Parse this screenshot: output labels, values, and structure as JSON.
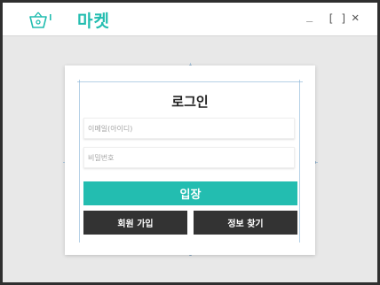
{
  "titlebar": {
    "app_title": "마켓",
    "logo_icon": "basket-icon",
    "minimize_label": "_",
    "maximize_label": "[ ]",
    "close_label": "✕"
  },
  "login": {
    "title": "로그인",
    "email_placeholder": "이메일(아이디)",
    "password_placeholder": "비밀번호",
    "submit_label": "입장",
    "signup_label": "회원 가입",
    "find_info_label": "정보 찾기"
  },
  "colors": {
    "accent": "#23bdb0",
    "dark_button": "#333333",
    "background": "#e8e8e8"
  }
}
